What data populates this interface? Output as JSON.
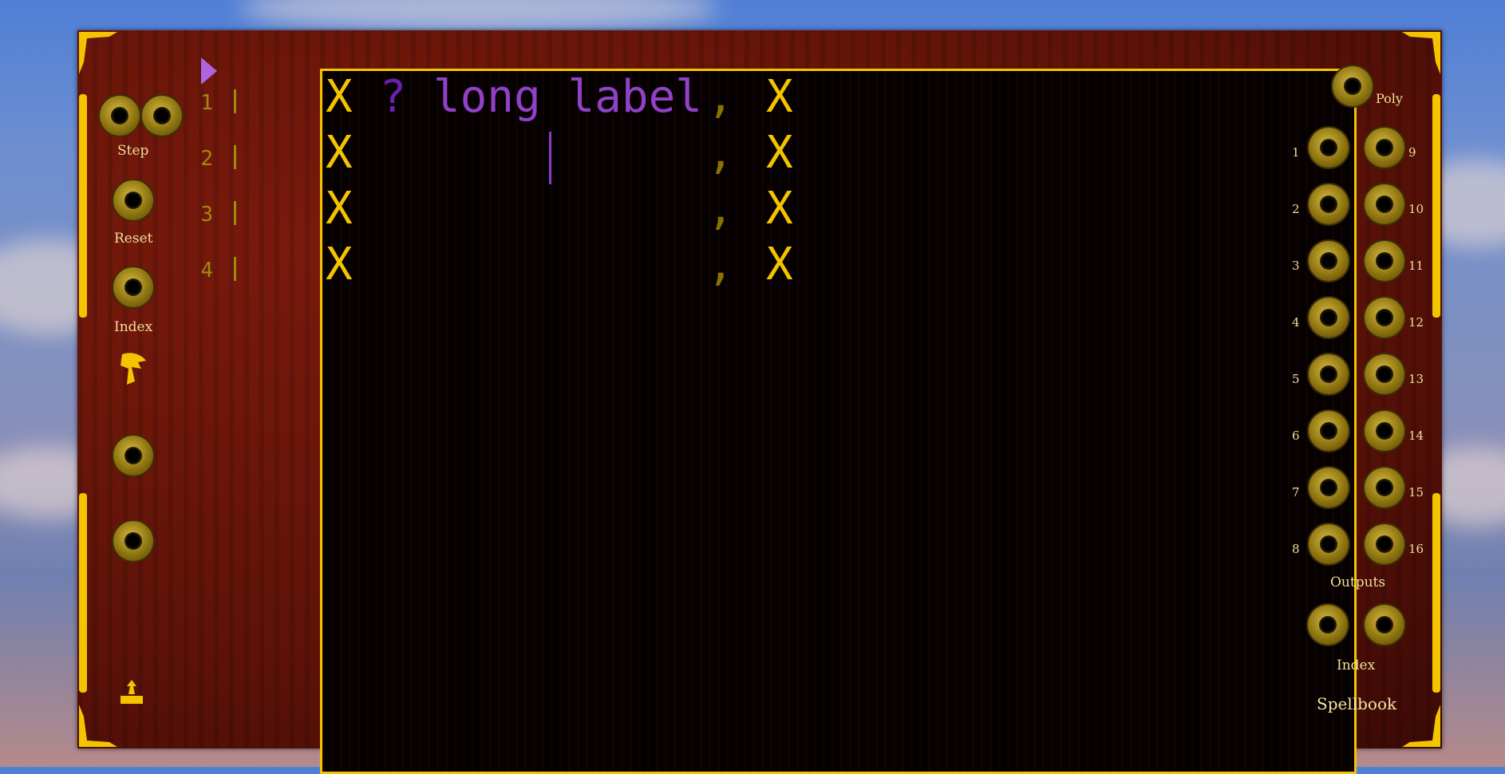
{
  "module": {
    "name": "Spellbook",
    "left_inputs": {
      "step_label": "Step",
      "reset_label": "Reset",
      "index_label": "Index"
    },
    "right": {
      "poly_label": "Poly",
      "outputs_label": "Outputs",
      "index_label": "Index",
      "output_numbers_left": [
        "1",
        "2",
        "3",
        "4",
        "5",
        "6",
        "7",
        "8"
      ],
      "output_numbers_right": [
        "9",
        "10",
        "11",
        "12",
        "13",
        "14",
        "15",
        "16"
      ]
    }
  },
  "editor": {
    "current_line": 1,
    "line_numbers": [
      "1",
      "2",
      "3",
      "4"
    ],
    "lines": [
      {
        "col1": "X",
        "label": " ? long label",
        "comma": ",",
        "col2": "X"
      },
      {
        "col1": "X",
        "label": "",
        "comma": ",",
        "col2": "X"
      },
      {
        "col1": "X",
        "label": "",
        "comma": ",",
        "col2": "X"
      },
      {
        "col1": "X",
        "label": "",
        "comma": ",",
        "col2": "X"
      }
    ]
  },
  "colors": {
    "accent_yellow": "#f5c400",
    "purple": "#9140c8",
    "panel": "#5c1208",
    "screen_bg": "#050101"
  }
}
